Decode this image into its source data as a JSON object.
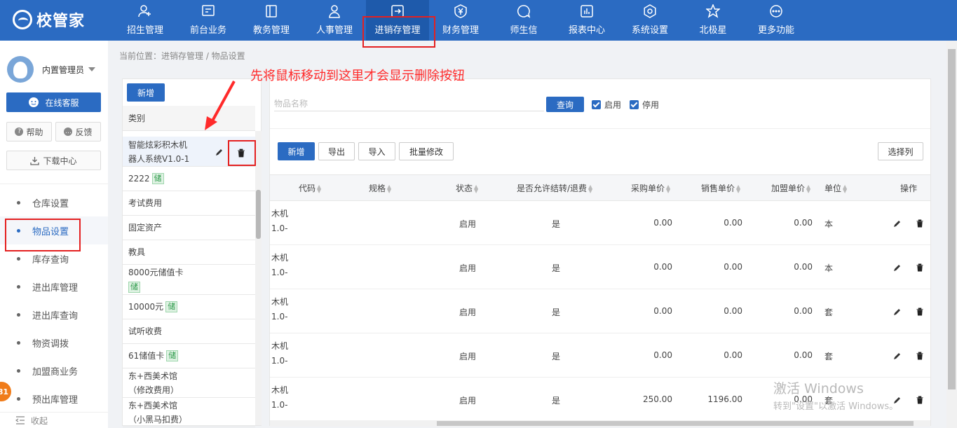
{
  "app": {
    "logo_text": "校管家"
  },
  "nav": {
    "items": [
      {
        "label": "招生管理",
        "icon": "user-add-icon"
      },
      {
        "label": "前台业务",
        "icon": "monitor-icon"
      },
      {
        "label": "教务管理",
        "icon": "book-icon"
      },
      {
        "label": "人事管理",
        "icon": "person-icon"
      },
      {
        "label": "进销存管理",
        "icon": "transfer-icon",
        "active": true
      },
      {
        "label": "财务管理",
        "icon": "yen-shield-icon"
      },
      {
        "label": "师生信",
        "icon": "chat-icon"
      },
      {
        "label": "报表中心",
        "icon": "chart-icon"
      },
      {
        "label": "系统设置",
        "icon": "gear-icon"
      },
      {
        "label": "北极星",
        "icon": "star-icon"
      },
      {
        "label": "更多功能",
        "icon": "more-icon"
      }
    ]
  },
  "sidebar": {
    "user_name": "内置管理员",
    "service_label": "在线客服",
    "help_label": "帮助",
    "feedback_label": "反馈",
    "download_label": "下载中心",
    "menu": [
      {
        "label": "仓库设置"
      },
      {
        "label": "物品设置",
        "active": true
      },
      {
        "label": "库存查询"
      },
      {
        "label": "进出库管理"
      },
      {
        "label": "进出库查询"
      },
      {
        "label": "物资调拨"
      },
      {
        "label": "加盟商业务"
      },
      {
        "label": "预出库管理"
      }
    ],
    "collapse_label": "收起",
    "badge_count": "81"
  },
  "breadcrumb": "当前位置：进销存管理 / 物品设置",
  "annotation_text": "先将鼠标移动到这里才会显示删除按钮",
  "category_panel": {
    "add_label": "新增",
    "header": "类别",
    "stored_tag": "储",
    "items": [
      {
        "line1": "智能炫彩积木机",
        "line2": "器人系统V1.0-1",
        "stored": false,
        "hover": true
      },
      {
        "line1": "2222",
        "stored": true
      },
      {
        "line1": "考试费用",
        "stored": false
      },
      {
        "line1": "固定资产",
        "stored": false
      },
      {
        "line1": "教具",
        "stored": false
      },
      {
        "line1": "8000元储值卡",
        "stored": true,
        "tag_newline": true
      },
      {
        "line1": "10000元",
        "stored": true
      },
      {
        "line1": "试听收费",
        "stored": false
      },
      {
        "line1": "61储值卡",
        "stored": true
      },
      {
        "line1": "东+西美术馆",
        "line2": "（修改费用）",
        "stored": false
      },
      {
        "line1": "东+西美术馆",
        "line2": "（小黑马扣费）",
        "stored": false
      }
    ]
  },
  "filter": {
    "search_placeholder": "物品名称",
    "query_label": "查询",
    "enabled_label": "启用",
    "disabled_label": "停用"
  },
  "toolbar": {
    "add_label": "新增",
    "export_label": "导出",
    "import_label": "导入",
    "batch_label": "批量修改",
    "columns_label": "选择列"
  },
  "table": {
    "columns": {
      "code": "代码",
      "spec": "规格",
      "status": "状态",
      "transfer": "是否允许结转/退费",
      "purchase": "采购单价",
      "sale": "销售单价",
      "franchise": "加盟单价",
      "unit": "单位",
      "action": "操作"
    },
    "rows": [
      {
        "name_l1": "木机",
        "name_l2": "1.0-",
        "status": "启用",
        "transfer": "是",
        "purchase": "0.00",
        "sale": "0.00",
        "franchise": "0.00",
        "unit": "本"
      },
      {
        "name_l1": "木机",
        "name_l2": "1.0-",
        "status": "启用",
        "transfer": "是",
        "purchase": "0.00",
        "sale": "0.00",
        "franchise": "0.00",
        "unit": "本"
      },
      {
        "name_l1": "木机",
        "name_l2": "1.0-",
        "status": "启用",
        "transfer": "是",
        "purchase": "0.00",
        "sale": "0.00",
        "franchise": "0.00",
        "unit": "套"
      },
      {
        "name_l1": "木机",
        "name_l2": "1.0-",
        "status": "启用",
        "transfer": "是",
        "purchase": "0.00",
        "sale": "0.00",
        "franchise": "0.00",
        "unit": "套"
      },
      {
        "name_l1": "木机",
        "name_l2": "1.0-",
        "status": "启用",
        "transfer": "是",
        "purchase": "250.00",
        "sale": "1196.00",
        "franchise": "0.00",
        "unit": "套"
      }
    ]
  },
  "watermark": {
    "line1": "激活 Windows",
    "line2": "转到\"设置\"以激活 Windows。"
  },
  "colors": {
    "brand": "#2b6bc2",
    "annotation": "#ff2a2a",
    "stored_tag": "#2f9b4c"
  }
}
